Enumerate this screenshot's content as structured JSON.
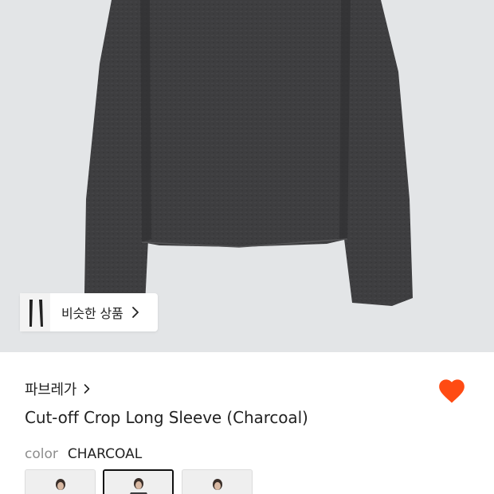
{
  "product": {
    "brand": "파브레가",
    "title": "Cut-off Crop Long Sleeve (Charcoal)",
    "color_label": "color",
    "color_value": "CHARCOAL",
    "wishlisted": true
  },
  "similar_button": {
    "label": "비슷한 상품"
  },
  "swatches": [
    {
      "name": "black",
      "selected": false
    },
    {
      "name": "charcoal",
      "selected": true
    },
    {
      "name": "grey",
      "selected": false
    }
  ],
  "colors": {
    "hero_background": "#e3e5e7",
    "garment": "#3d3d3f",
    "heart": "#ff4b13"
  },
  "icons": [
    "chevron-right-icon",
    "heart-icon"
  ]
}
